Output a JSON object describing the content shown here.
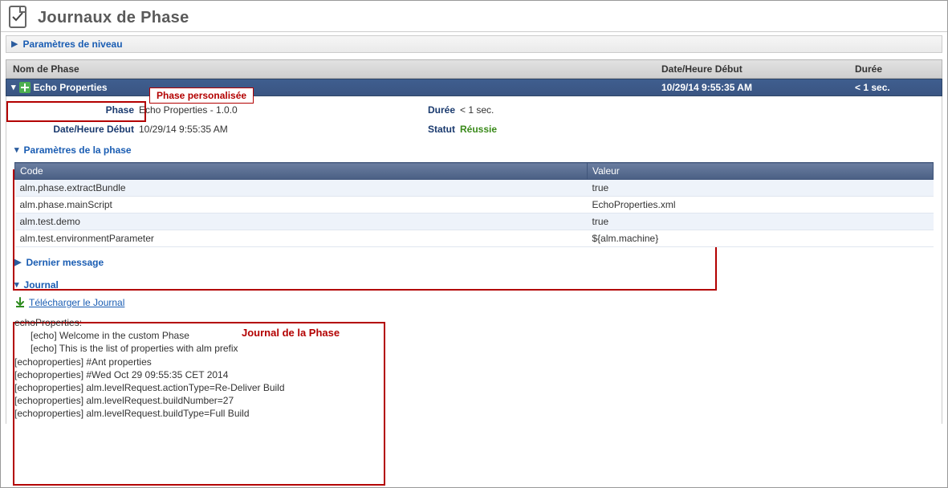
{
  "header": {
    "title": "Journaux de Phase"
  },
  "level_params": {
    "label": "Paramètres de niveau"
  },
  "columns": {
    "name": "Nom de Phase",
    "start": "Date/Heure Début",
    "duration": "Durée"
  },
  "phase_row": {
    "name": "Echo Properties",
    "start": "10/29/14 9:55:35 AM",
    "duration": "< 1 sec."
  },
  "annotations": {
    "custom_phase_label": "Phase personalisée",
    "phase_params_label": "Paramètres de la Phase",
    "phase_journal_label": "Journal de la Phase"
  },
  "details": {
    "phase_label": "Phase",
    "phase_value": "Echo Properties - 1.0.0",
    "start_label": "Date/Heure Début",
    "start_value": "10/29/14 9:55:35 AM",
    "duration_label": "Durée",
    "duration_value": "< 1 sec.",
    "status_label": "Statut",
    "status_value": "Réussie"
  },
  "phase_params": {
    "section_label": "Paramètres de la phase",
    "col_code": "Code",
    "col_value": "Valeur",
    "rows": [
      {
        "code": "alm.phase.extractBundle",
        "value": "true"
      },
      {
        "code": "alm.phase.mainScript",
        "value": "EchoProperties.xml"
      },
      {
        "code": "alm.test.demo",
        "value": "true"
      },
      {
        "code": "alm.test.environmentParameter",
        "value": "${alm.machine}"
      }
    ]
  },
  "last_message": {
    "label": "Dernier message"
  },
  "journal": {
    "section_label": "Journal",
    "download_label": "Télécharger le Journal",
    "lines": [
      "echoProperties:",
      "      [echo] Welcome in the custom Phase",
      "      [echo] This is the list of properties with alm prefix",
      "[echoproperties] #Ant properties",
      "[echoproperties] #Wed Oct 29 09:55:35 CET 2014",
      "[echoproperties] alm.levelRequest.actionType=Re-Deliver Build",
      "[echoproperties] alm.levelRequest.buildNumber=27",
      "[echoproperties] alm.levelRequest.buildType=Full Build"
    ]
  }
}
